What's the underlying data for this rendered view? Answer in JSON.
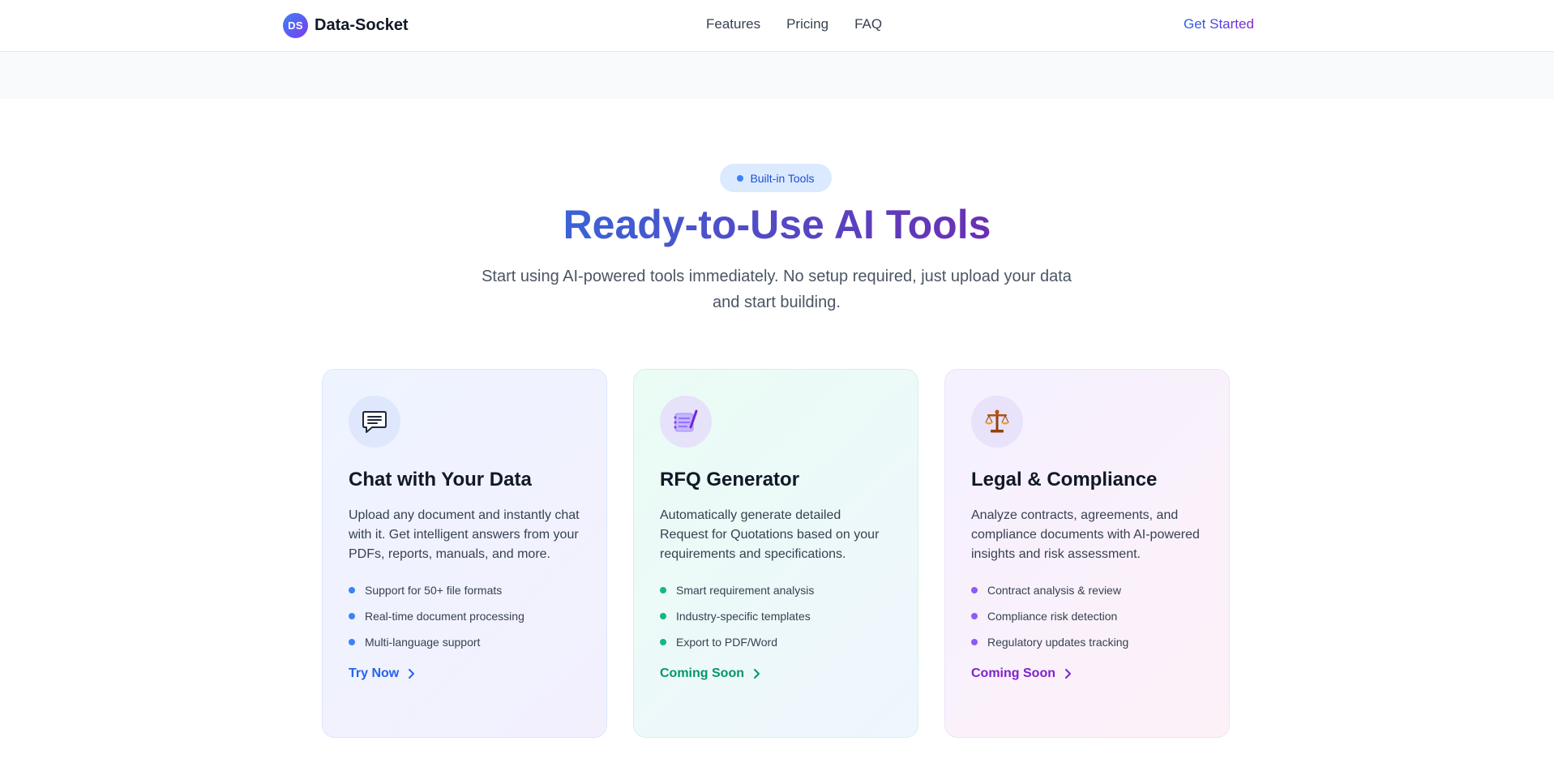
{
  "nav": {
    "logo_initials": "DS",
    "brand": "Data-Socket",
    "links": [
      "Features",
      "Pricing",
      "FAQ"
    ],
    "cta": "Get Started"
  },
  "hero": {
    "badge": "Built-in Tools",
    "title": "Ready-to-Use AI Tools",
    "subtitle": "Start using AI-powered tools immediately. No setup required, just upload your data and start building."
  },
  "cards": [
    {
      "icon": "chat-bubble-icon",
      "title": "Chat with Your Data",
      "description": "Upload any document and instantly chat with it. Get intelligent answers from your PDFs, reports, manuals, and more.",
      "features": [
        "Support for 50+ file formats",
        "Real-time document processing",
        "Multi-language support"
      ],
      "action": "Try Now",
      "accent": "#2563eb"
    },
    {
      "icon": "notepad-pencil-icon",
      "title": "RFQ Generator",
      "description": "Automatically generate detailed Request for Quotations based on your requirements and specifications.",
      "features": [
        "Smart requirement analysis",
        "Industry-specific templates",
        "Export to PDF/Word"
      ],
      "action": "Coming Soon",
      "accent": "#059669"
    },
    {
      "icon": "balance-scale-icon",
      "title": "Legal & Compliance",
      "description": "Analyze contracts, agreements, and compliance documents with AI-powered insights and risk assessment.",
      "features": [
        "Contract analysis & review",
        "Compliance risk detection",
        "Regulatory updates tracking"
      ],
      "action": "Coming Soon",
      "accent": "#7e22ce"
    }
  ]
}
